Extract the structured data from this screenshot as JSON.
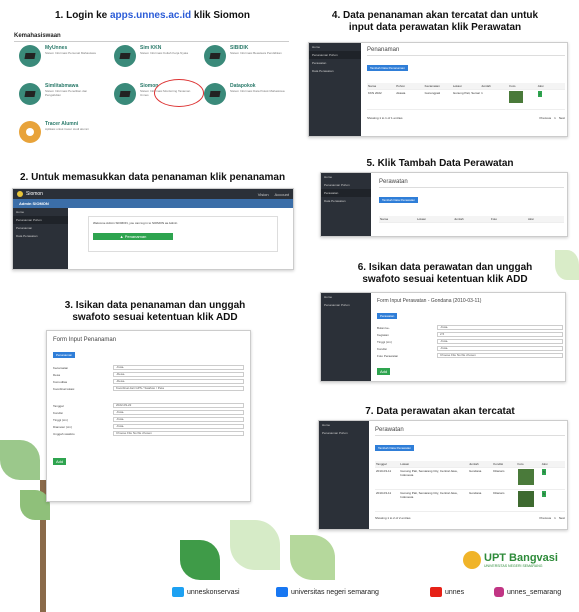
{
  "steps": {
    "s1_pre": "1. Login ke ",
    "s1_link": "apps.unnes.ac.id",
    "s1_post": " klik Siomon",
    "s2": "2. Untuk memasukkan data penanaman klik penanaman",
    "s3a": "3.  Isikan data penanaman dan unggah",
    "s3b": "swafoto sesuai ketentuan klik ADD",
    "s4a": "4. Data penanaman akan tercatat dan untuk",
    "s4b": "input data perawatan klik Perawatan",
    "s5": "5. Klik Tambah Data Perawatan",
    "s6a": "6.  Isikan data perawatan dan unggah",
    "s6b": "swafoto sesuai ketentuan klik ADD",
    "s7": "7. Data perawatan akan tercatat"
  },
  "shot1": {
    "section": "Kemahasiswaan",
    "apps": [
      {
        "name": "MyUnnes",
        "desc": "Sistem Informasi Personal Mahasiswa"
      },
      {
        "name": "Sim KKN",
        "desc": "Sistem Informasi Kuliah Kerja Nyata"
      },
      {
        "name": "SIBIDIK",
        "desc": "Sistem Informasi Beasiswa Pendidikan"
      },
      {
        "name": "Simlitabmawa",
        "desc": "Sistem Informasi Penelitian dan Pengabdian"
      },
      {
        "name": "Siomon",
        "desc": "Sistem Informasi Monitoring Tanaman Unnes"
      },
      {
        "name": "Datapokok",
        "desc": "Sistem Informasi Data Pokok Mahasiswa"
      },
      {
        "name": "Tracer Alumni",
        "desc": "Aplikasi untuk tracer studi alumni"
      }
    ]
  },
  "shot2": {
    "brand": "Siomon",
    "user": "Admin SIOMON",
    "menu": [
      "Home",
      "Penanaman Pohon",
      "Penanaman",
      "Data Perawatan"
    ],
    "welcome": "Welcome Admin SIOMON, you can log in to SIOMON as Admin",
    "button": "Penanaman",
    "nav": [
      "Vision",
      "Account"
    ]
  },
  "shot3": {
    "title": "Form Input Penanaman",
    "add": "Penanaman",
    "fields": [
      {
        "label": "Kecamatan",
        "value": "-Kota-"
      },
      {
        "label": "Desa",
        "value": "-Desa-"
      },
      {
        "label": "Komoditas",
        "value": "-Desa-"
      },
      {
        "label": "Koordinat lokasi",
        "value": "Koordinat dari GPS / Swafoto / Peta"
      },
      {
        "label": "Tanggal",
        "value": "2022-09-22"
      },
      {
        "label": "Kondisi",
        "value": "-Kota-"
      },
      {
        "label": "Tinggi (cm)",
        "value": "-Kota-"
      },
      {
        "label": "Diameter (cm)",
        "value": "-Kota-"
      },
      {
        "label": "Unggah swafoto",
        "value": "Choose File  No file chosen"
      }
    ],
    "submit": "Add"
  },
  "shot4": {
    "title": "Penanaman",
    "btn": "Tambah Data Penanaman",
    "cols": [
      "Nama",
      "Pohon",
      "Kecamatan",
      "Lokasi",
      "Jumlah",
      "Foto",
      "Aksi"
    ],
    "row": [
      "KKN 2022",
      "Akasia",
      "Gunungpati",
      "Gunung Pati, Semarang City, Central Java, Indonesia",
      "1",
      "",
      ""
    ],
    "footer": "Showing 1 to 1 of 1 entries",
    "pager": [
      "Previous",
      "1",
      "Next"
    ],
    "menu": [
      "Home",
      "Penanaman Pohon",
      "Perawatan",
      "Data Perawatan"
    ]
  },
  "shot5": {
    "title": "Perawatan",
    "btn": "Tambah Data Perawatan",
    "cols": [
      "Nama",
      "Lokasi",
      "Jumlah",
      "Foto",
      "Aksi"
    ],
    "menu": [
      "Home",
      "Penanaman Pohon",
      "Perawatan",
      "Data Perawatan"
    ]
  },
  "shot6": {
    "title": "Form Input Perawatan - Gondana (2010-03-11)",
    "add": "Perawatan",
    "fields": [
      {
        "label": "Bulan ke-",
        "value": "-Kota-"
      },
      {
        "label": "Kegiatan",
        "value": "2.5"
      },
      {
        "label": "Tinggi (cm)",
        "value": "-Kota-"
      },
      {
        "label": "Kondisi",
        "value": "-Kota-"
      },
      {
        "label": "Foto Perawatan",
        "value": "Choose File  No file chosen"
      }
    ],
    "submit": "Add",
    "menu": [
      "Home",
      "Penanaman Pohon"
    ]
  },
  "shot7": {
    "title": "Perawatan",
    "btn": "Tambah Data Perawatan",
    "cols": [
      "Tanggal",
      "Lokasi",
      "Jumlah",
      "Kondisi",
      "Foto",
      "Aksi"
    ],
    "rows": [
      [
        "2010-03-11",
        "Gunung Pati, Semarang City, Central Java, Indonesia",
        "Gondana",
        "Ditanam"
      ],
      [
        "2010-03-11",
        "Gunung Pati, Semarang City, Central Java, Indonesia",
        "Gondana",
        "Ditanam"
      ]
    ],
    "footer": "Showing 1 to 2 of 2 entries",
    "pager": [
      "Previous",
      "1",
      "Next"
    ],
    "menu": [
      "Home",
      "Penanaman Pohon"
    ]
  },
  "footer": {
    "twitter": "unneskonservasi",
    "facebook": "universitas negeri semarang",
    "youtube": "unnes",
    "instagram": "unnes_semarang",
    "logo": "UPT Bangvasi",
    "logo_sub": "UNIVERSITAS NEGERI SEMARANG"
  },
  "colors": {
    "green": "#2ea44f",
    "blue": "#2f7ed8",
    "dark": "#2b3038",
    "teal": "#3a8a7a"
  }
}
